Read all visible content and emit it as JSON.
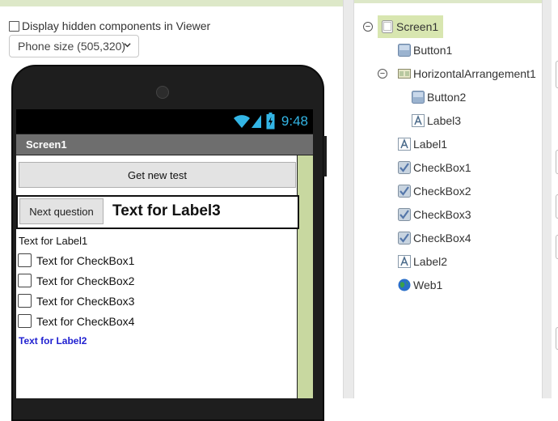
{
  "viewer": {
    "hidden_components_label": "Display hidden components in Viewer",
    "phone_size": "Phone size (505,320)",
    "status_time": "9:48",
    "screen_title": "Screen1",
    "button1_text": "Get new test",
    "button2_text": "Next question",
    "label3_text": "Text for Label3",
    "label1_text": "Text for Label1",
    "checkboxes": [
      "Text for CheckBox1",
      "Text for CheckBox2",
      "Text for CheckBox3",
      "Text for CheckBox4"
    ],
    "label2_text": "Text for Label2"
  },
  "components": {
    "tree": [
      {
        "name": "Screen1",
        "icon": "screen-icon",
        "selected": true
      },
      {
        "name": "Button1",
        "icon": "button-icon"
      },
      {
        "name": "HorizontalArrangement1",
        "icon": "horizontal-arrangement-icon"
      },
      {
        "name": "Button2",
        "icon": "button-icon"
      },
      {
        "name": "Label3",
        "icon": "label-icon"
      },
      {
        "name": "Label1",
        "icon": "label-icon"
      },
      {
        "name": "CheckBox1",
        "icon": "checkbox-icon"
      },
      {
        "name": "CheckBox2",
        "icon": "checkbox-icon"
      },
      {
        "name": "CheckBox3",
        "icon": "checkbox-icon"
      },
      {
        "name": "CheckBox4",
        "icon": "checkbox-icon"
      },
      {
        "name": "Label2",
        "icon": "label-icon"
      },
      {
        "name": "Web1",
        "icon": "web-icon"
      }
    ]
  },
  "colors": {
    "accent_green": "#d8e6b0",
    "label2_blue": "#1f1fd0",
    "status_time_blue": "#33b5e5"
  }
}
